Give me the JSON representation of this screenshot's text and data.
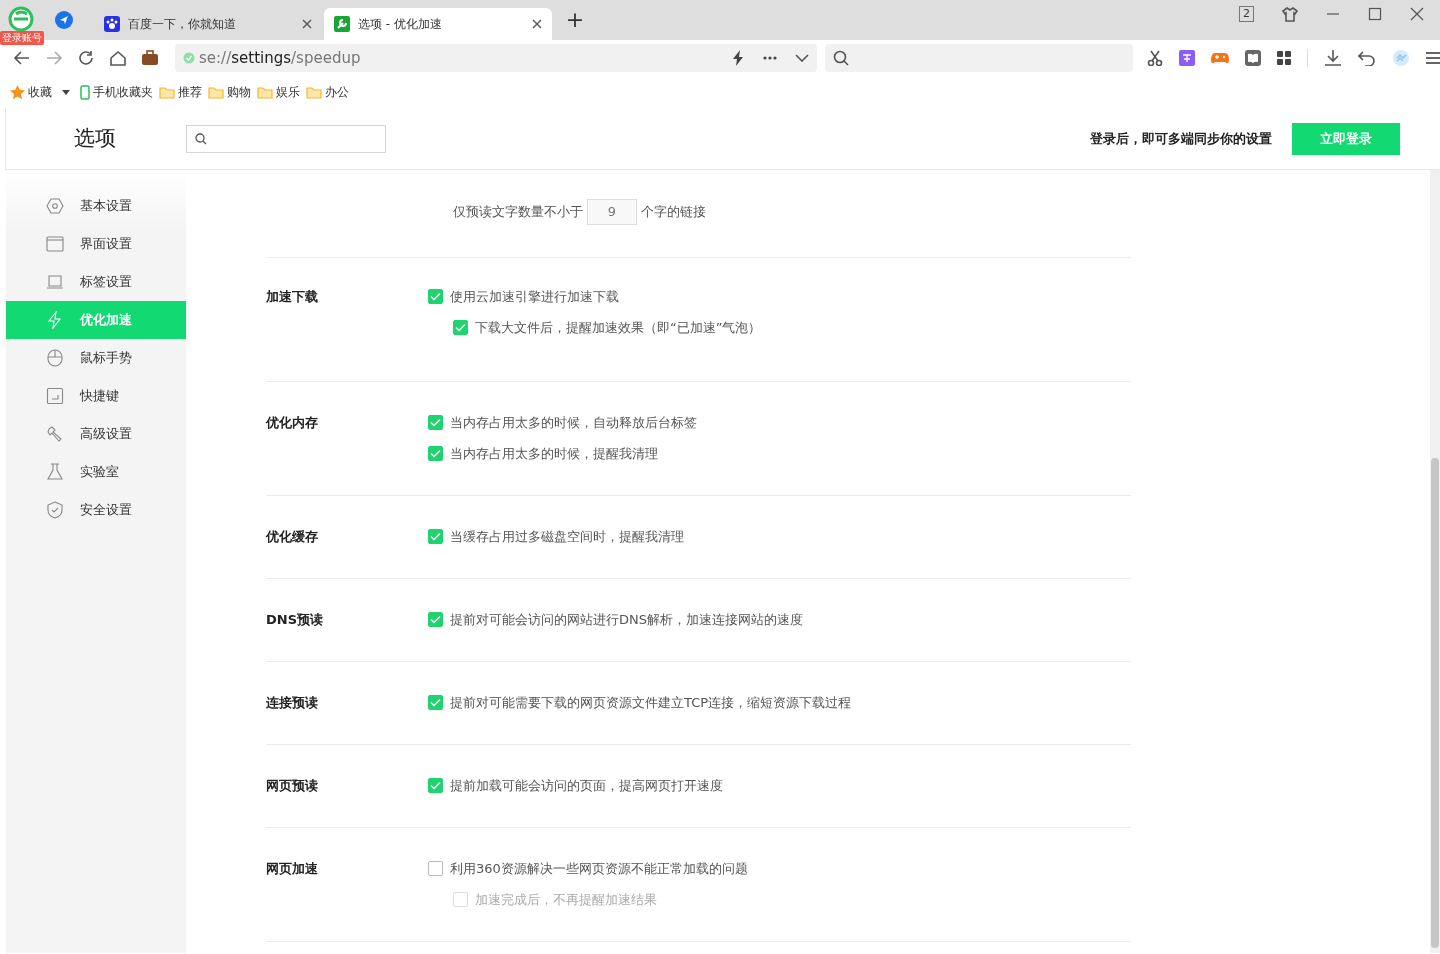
{
  "browser": {
    "account_badge": "登录账号",
    "tabs": [
      {
        "title": "百度一下，你就知道",
        "selected": false
      },
      {
        "title": "选项 - 优化加速",
        "selected": true
      }
    ],
    "new_tab": "+",
    "tab_count": "2",
    "address": {
      "scheme": "se://",
      "host": "settings",
      "path": "/speedup"
    },
    "bookmarks": [
      {
        "label": "收藏",
        "kind": "star"
      },
      {
        "label": "手机收藏夹",
        "kind": "phone"
      },
      {
        "label": "推荐",
        "kind": "folder"
      },
      {
        "label": "购物",
        "kind": "folder"
      },
      {
        "label": "娱乐",
        "kind": "folder"
      },
      {
        "label": "办公",
        "kind": "folder"
      }
    ]
  },
  "page": {
    "title": "选项",
    "login_prompt": "登录后，即可多端同步你的设置",
    "login_button": "立即登录",
    "sidebar": {
      "items": [
        {
          "label": "基本设置",
          "kind": "gear",
          "selected": false
        },
        {
          "label": "界面设置",
          "kind": "window",
          "selected": false
        },
        {
          "label": "标签设置",
          "kind": "tab",
          "selected": false
        },
        {
          "label": "优化加速",
          "kind": "bolt",
          "selected": true
        },
        {
          "label": "鼠标手势",
          "kind": "mouse",
          "selected": false
        },
        {
          "label": "快捷键",
          "kind": "keyboard",
          "selected": false
        },
        {
          "label": "高级设置",
          "kind": "wrench",
          "selected": false
        },
        {
          "label": "实验室",
          "kind": "flask",
          "selected": false
        },
        {
          "label": "安全设置",
          "kind": "shield",
          "selected": false
        }
      ]
    },
    "preread": {
      "before": "仅预读文字数量不小于",
      "value": "9",
      "after": "个字的链接"
    },
    "sections": [
      {
        "heading": "加速下载",
        "options": [
          {
            "label": "使用云加速引擎进行加速下载",
            "checked": true,
            "disabled": false,
            "children": [
              {
                "label": "下载大文件后，提醒加速效果（即“已加速”气泡）",
                "checked": true,
                "disabled": false
              }
            ]
          }
        ]
      },
      {
        "heading": "优化内存",
        "options": [
          {
            "label": "当内存占用太多的时候，自动释放后台标签",
            "checked": true,
            "disabled": false
          },
          {
            "label": "当内存占用太多的时候，提醒我清理",
            "checked": true,
            "disabled": false
          }
        ]
      },
      {
        "heading": "优化缓存",
        "options": [
          {
            "label": "当缓存占用过多磁盘空间时，提醒我清理",
            "checked": true,
            "disabled": false
          }
        ]
      },
      {
        "heading": "DNS预读",
        "options": [
          {
            "label": "提前对可能会访问的网站进行DNS解析，加速连接网站的速度",
            "checked": true,
            "disabled": false
          }
        ]
      },
      {
        "heading": "连接预读",
        "options": [
          {
            "label": "提前对可能需要下载的网页资源文件建立TCP连接，缩短资源下载过程",
            "checked": true,
            "disabled": false
          }
        ]
      },
      {
        "heading": "网页预读",
        "options": [
          {
            "label": "提前加载可能会访问的页面，提高网页打开速度",
            "checked": true,
            "disabled": false
          }
        ]
      },
      {
        "heading": "网页加速",
        "options": [
          {
            "label": "利用360资源解决一些网页资源不能正常加载的问题",
            "checked": false,
            "disabled": false,
            "children": [
              {
                "label": "加速完成后，不再提醒加速结果",
                "checked": false,
                "disabled": true
              }
            ]
          }
        ]
      }
    ]
  }
}
